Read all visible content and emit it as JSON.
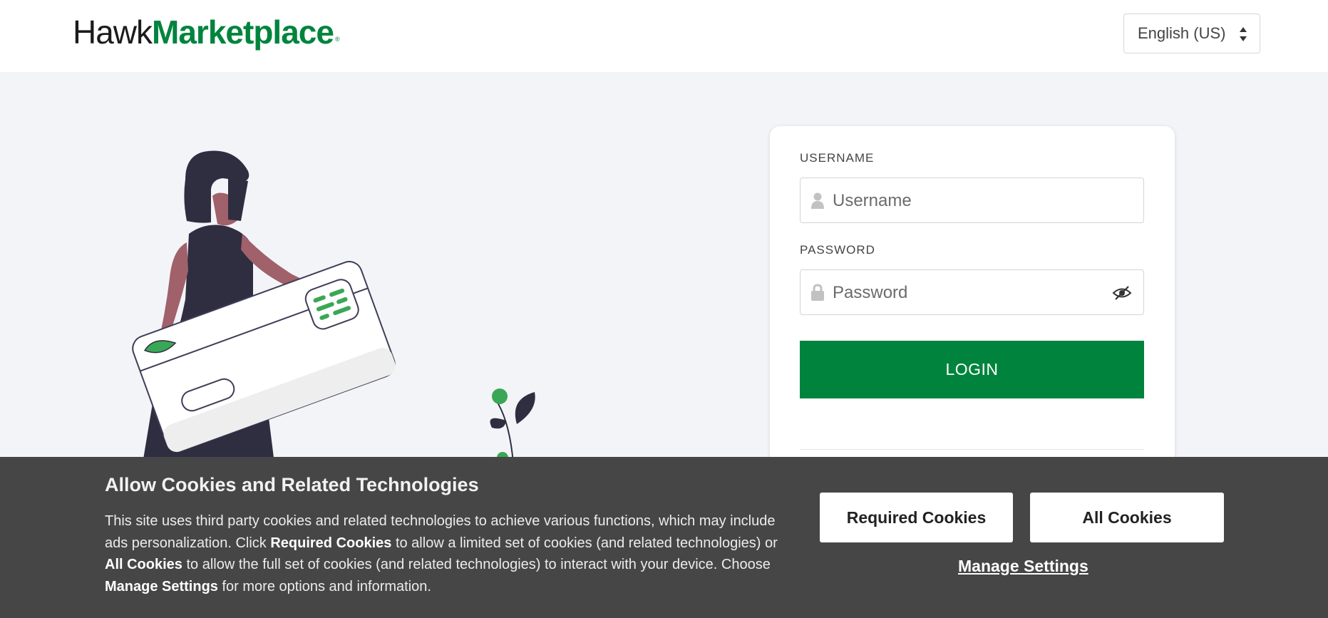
{
  "header": {
    "logo_part1": "Hawk",
    "logo_part2": "Marketplace",
    "logo_mark": "®",
    "language": "English (US)"
  },
  "login": {
    "username_label": "USERNAME",
    "username_placeholder": "Username",
    "password_label": "PASSWORD",
    "password_placeholder": "Password",
    "login_button": "LOGIN"
  },
  "cookie_banner": {
    "title": "Allow Cookies and Related Technologies",
    "text_1": "This site uses third party cookies and related technologies to achieve various functions, which may include ads personalization. Click ",
    "bold_required": "Required Cookies",
    "text_2": " to allow a limited set of cookies (and related technologies) or ",
    "bold_all": "All Cookies",
    "text_3": " to allow the full set of cookies (and related technologies) to interact with your device. Choose ",
    "bold_manage": "Manage Settings",
    "text_4": " for more options and information.",
    "required_button": "Required Cookies",
    "all_button": "All Cookies",
    "manage_link": "Manage Settings"
  },
  "icons": {
    "username": "user-icon",
    "password": "lock-icon",
    "toggle": "eye-slash-icon",
    "language": "sort-caret-icon"
  },
  "colors": {
    "brand_green": "#00843d",
    "banner_bg": "#464646",
    "page_bg": "#f3f4f8"
  }
}
